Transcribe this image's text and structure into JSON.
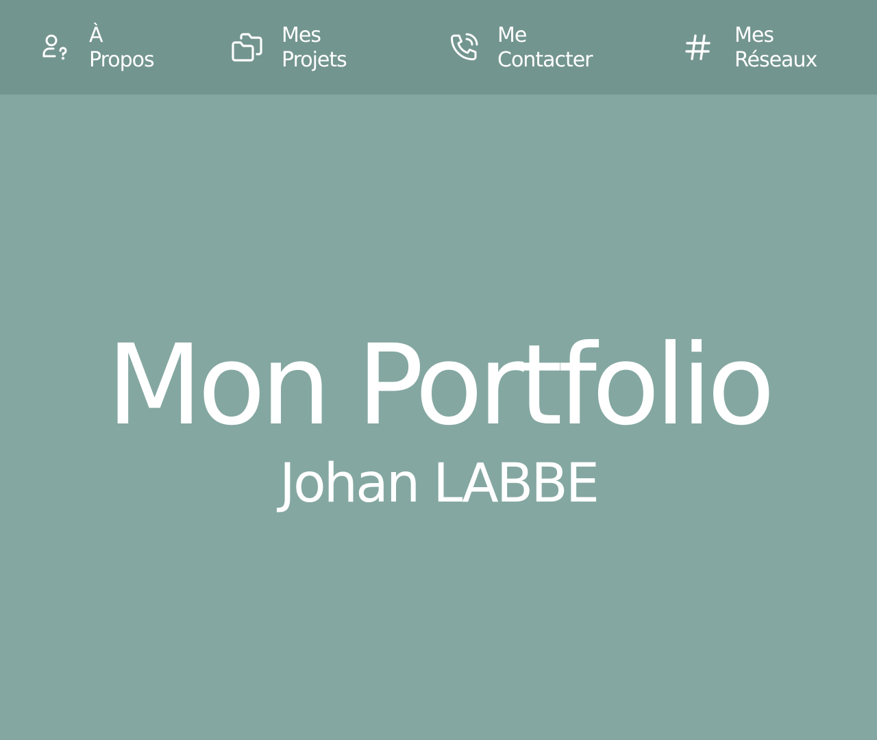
{
  "nav": {
    "items": [
      {
        "line1": "À",
        "line2": "Propos",
        "icon": "user-question-icon"
      },
      {
        "line1": "Mes",
        "line2": "Projets",
        "icon": "folders-icon"
      },
      {
        "line1": "Me",
        "line2": "Contacter",
        "icon": "phone-call-icon"
      },
      {
        "line1": "Mes",
        "line2": "Réseaux",
        "icon": "hashtag-icon"
      }
    ]
  },
  "hero": {
    "title": "Mon Portfolio",
    "subtitle": "Johan LABBE"
  },
  "colors": {
    "background": "#84a7a1",
    "nav_background": "#73958f",
    "text": "#ffffff"
  }
}
